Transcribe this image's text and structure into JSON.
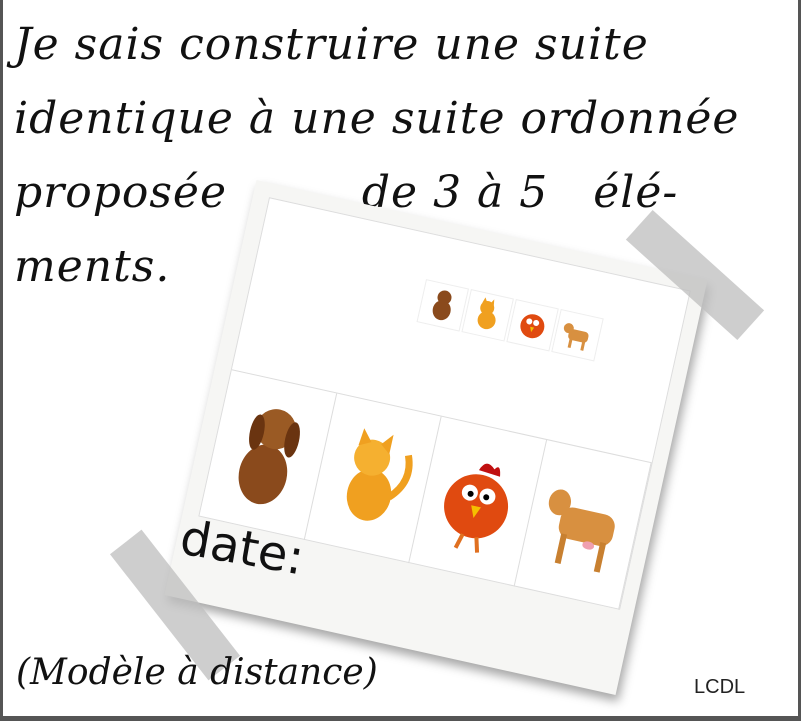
{
  "title": {
    "lines": [
      "Je sais construire une suite",
      "identique à une suite ordonnée",
      "proposée         de 3 à 5   élé-",
      "ments."
    ]
  },
  "photo": {
    "model_row": [
      "dog",
      "cat",
      "chicken",
      "cow"
    ],
    "answer_row": [
      "dog",
      "cat",
      "chicken",
      "cow"
    ]
  },
  "date_label": "date:",
  "footer": "(Modèle à distance)",
  "signature": "LCDL",
  "colors": {
    "dog": "#8a4a1c",
    "cat": "#f0a020",
    "chicken": "#e04a10",
    "cow": "#d89040",
    "tape": "#bebebe",
    "frame": "#555555"
  }
}
